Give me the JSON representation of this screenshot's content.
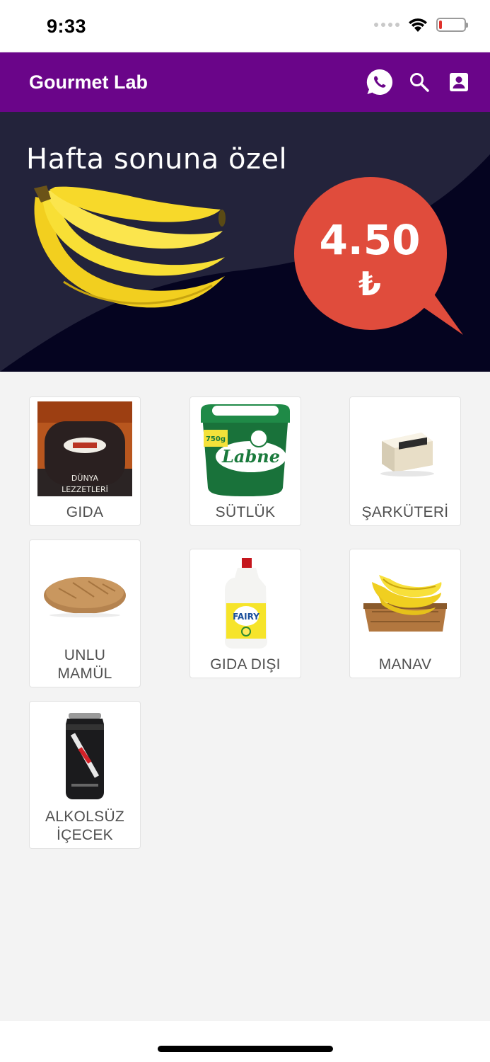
{
  "status_bar": {
    "time": "9:33"
  },
  "app_bar": {
    "title": "Gourmet Lab",
    "actions": [
      "whatsapp-icon",
      "search-icon",
      "account-box-icon"
    ]
  },
  "banner": {
    "headline": "Hafta sonuna özel",
    "price": "4.50",
    "currency": "₺",
    "colors": {
      "background": "#050420",
      "bubble": "#e04c3c",
      "banana": "#f5d422"
    }
  },
  "categories": [
    {
      "label_line1": "GIDA",
      "label_line2": "",
      "image": "cookie-package"
    },
    {
      "label_line1": "SÜTLÜK",
      "label_line2": "",
      "image": "labne-tub"
    },
    {
      "label_line1": "ŞARKÜTERİ",
      "label_line2": "",
      "image": "cheese-box"
    },
    {
      "label_line1": "UNLU",
      "label_line2": "MAMÜL",
      "image": "bread-loaf"
    },
    {
      "label_line1": "GIDA DIŞI",
      "label_line2": "",
      "image": "dish-soap-bottle"
    },
    {
      "label_line1": "MANAV",
      "label_line2": "",
      "image": "banana-crate"
    },
    {
      "label_line1": "ALKOLSÜZ",
      "label_line2": "İÇECEK",
      "image": "coffee-can"
    }
  ],
  "colors": {
    "primary": "#6a0589",
    "background": "#f3f3f3"
  }
}
